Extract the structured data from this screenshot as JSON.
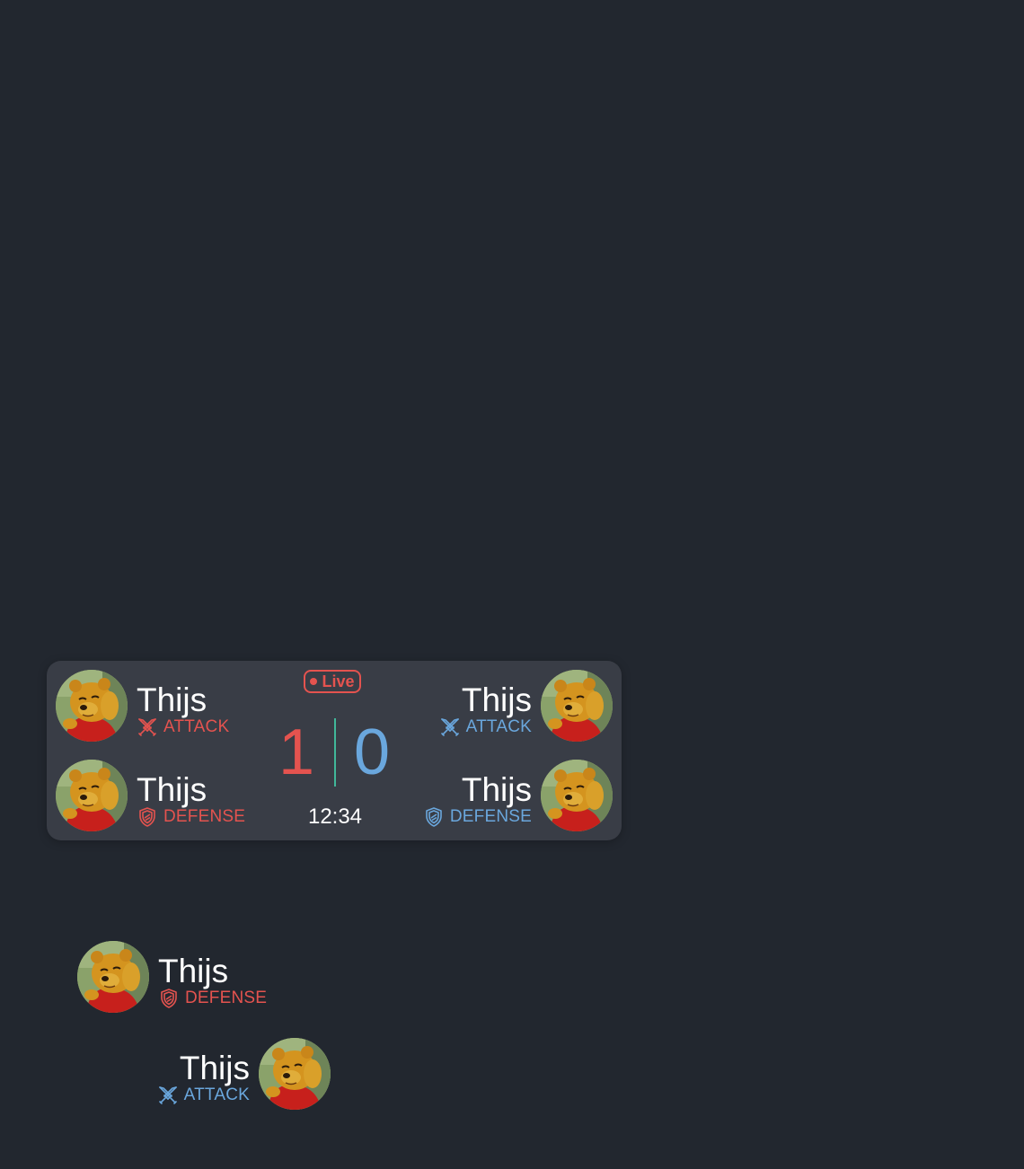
{
  "scoreboard": {
    "status": "Live",
    "home_score": "1",
    "away_score": "0",
    "clock": "12:34",
    "home_attack": {
      "name": "Thijs",
      "role": "ATTACK"
    },
    "home_defense": {
      "name": "Thijs",
      "role": "DEFENSE"
    },
    "away_attack": {
      "name": "Thijs",
      "role": "ATTACK"
    },
    "away_defense": {
      "name": "Thijs",
      "role": "DEFENSE"
    }
  },
  "standalone_players": [
    {
      "name": "Thijs",
      "role": "DEFENSE",
      "team": "red"
    },
    {
      "name": "Thijs",
      "role": "ATTACK",
      "team": "blue"
    }
  ],
  "colors": {
    "background": "#22272f",
    "card": "#393d46",
    "home": "#e4534f",
    "away": "#6aa7dd",
    "divider": "#41b89a"
  },
  "icons": {
    "attack": "crossed-swords-icon",
    "defense": "shield-icon",
    "status": "live-dot-icon"
  }
}
